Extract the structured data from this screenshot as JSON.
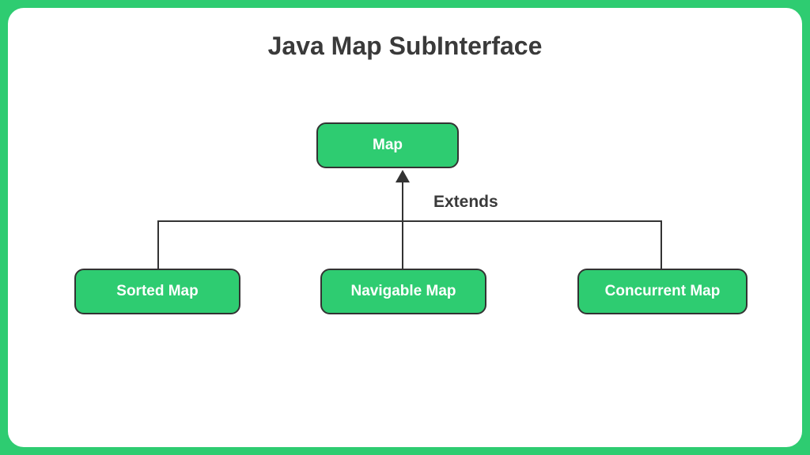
{
  "title": "Java Map SubInterface",
  "relationship_label": "Extends",
  "nodes": {
    "root": "Map",
    "children": [
      {
        "label": "Sorted Map"
      },
      {
        "label": "Navigable Map"
      },
      {
        "label": "Concurrent Map"
      }
    ]
  },
  "colors": {
    "accent": "#2ecc71",
    "text": "#3a3a3a",
    "border": "#333333",
    "node_text": "#ffffff"
  }
}
